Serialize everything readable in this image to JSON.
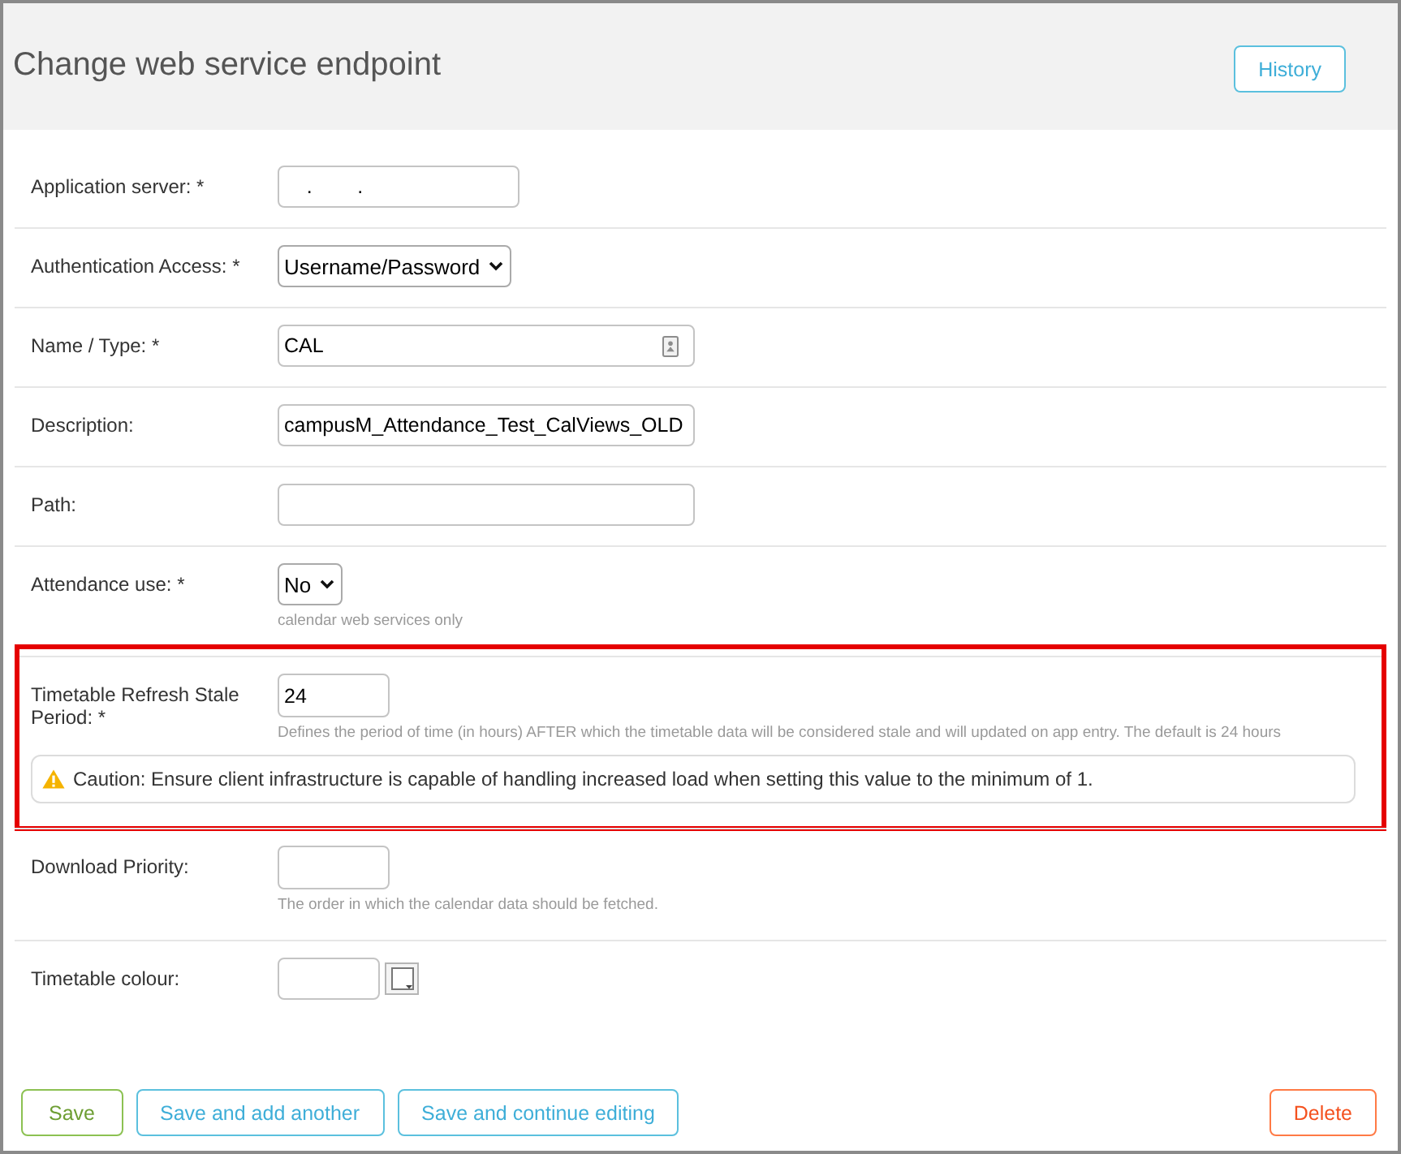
{
  "header": {
    "title": "Change web service endpoint",
    "buttons": [
      {
        "label": "History",
        "kind": "info"
      }
    ]
  },
  "fields": [
    {
      "label": "Application server: *",
      "kind": "host",
      "value": "    .        .",
      "highlighted": false
    },
    {
      "label": "Authentication Access: *",
      "kind": "select",
      "value": "Username/Password",
      "highlighted": false
    },
    {
      "label": "Name / Type: *",
      "kind": "lookup",
      "value": "CAL",
      "highlighted": false
    },
    {
      "label": "Description:",
      "kind": "text",
      "value": "campusM_Attendance_Test_CalViews_OLD",
      "highlighted": false
    },
    {
      "label": "Path:",
      "kind": "text",
      "highlighted": false
    },
    {
      "label": "Attendance use: *",
      "kind": "select",
      "value": "No",
      "help": "calendar web services only",
      "highlighted": false
    },
    {
      "label": "Timetable Refresh Stale Period: *",
      "kind": "number",
      "value": "24",
      "help": "Defines the period of time (in hours) AFTER which the timetable data will be considered stale and will updated on app entry. The default is 24 hours",
      "caution": "Caution: Ensure client infrastructure is capable of handling increased load when setting this value to the minimum of 1.",
      "highlighted": true
    },
    {
      "label": "Download Priority:",
      "kind": "number",
      "help": "The order in which the calendar data should be fetched.",
      "highlighted": false
    },
    {
      "label": "Timetable colour:",
      "kind": "color",
      "highlighted": false
    }
  ],
  "actions": [
    {
      "label": "Save",
      "kind": "success"
    },
    {
      "label": "Save and add another",
      "kind": "info"
    },
    {
      "label": "Save and continue editing",
      "kind": "info"
    },
    {
      "label": "Delete",
      "kind": "danger"
    }
  ]
}
